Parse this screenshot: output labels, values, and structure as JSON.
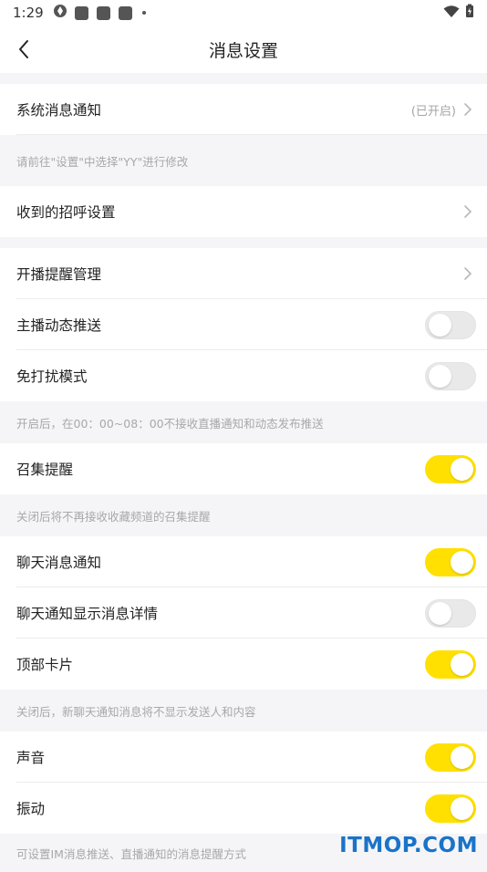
{
  "status_bar": {
    "time": "1:29"
  },
  "header": {
    "title": "消息设置"
  },
  "sections": {
    "system": {
      "label": "系统消息通知",
      "value": "(已开启)",
      "note": "请前往\"设置\"中选择\"YY\"进行修改"
    },
    "greeting": {
      "label": "收到的招呼设置"
    },
    "broadcast": {
      "label": "开播提醒管理"
    },
    "anchor_push": {
      "label": "主播动态推送",
      "on": false
    },
    "dnd": {
      "label": "免打扰模式",
      "on": false,
      "note": "开启后，在00：00~08：00不接收直播通知和动态发布推送"
    },
    "summon": {
      "label": "召集提醒",
      "on": true,
      "note": "关闭后将不再接收收藏频道的召集提醒"
    },
    "chat_notify": {
      "label": "聊天消息通知",
      "on": true
    },
    "chat_detail": {
      "label": "聊天通知显示消息详情",
      "on": false
    },
    "top_card": {
      "label": "顶部卡片",
      "on": true,
      "note": "关闭后，新聊天通知消息将不显示发送人和内容"
    },
    "sound": {
      "label": "声音",
      "on": true
    },
    "vibrate": {
      "label": "振动",
      "on": true,
      "note": "可设置IM消息推送、直播通知的消息提醒方式"
    }
  },
  "watermark": "ITMOP.COM",
  "colors": {
    "accent": "#ffe000",
    "background": "#f5f5f7"
  }
}
